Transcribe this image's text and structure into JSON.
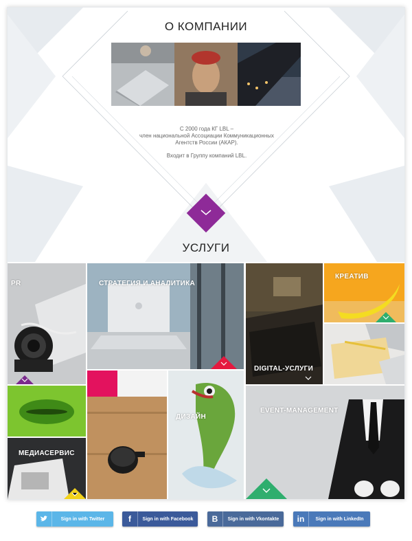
{
  "about": {
    "title": "О КОМПАНИИ",
    "desc_line1": "С 2000 года КГ LBL –",
    "desc_line2": "член национальной Ассоциации Коммуникационных",
    "desc_line3": "Агентств России (АКАР).",
    "desc_line4": "Входит в Группу компаний LBL."
  },
  "services": {
    "title": "УСЛУГИ",
    "tiles": [
      {
        "label": "PR",
        "accent": "#7b2b8e"
      },
      {
        "label": "СТРАТЕГИЯ И АНАЛИТИКА",
        "accent": "#e5193f"
      },
      {
        "label": "DIGITAL-УСЛУГИ",
        "accent": "#2b2b2b"
      },
      {
        "label": "КРЕАТИВ",
        "accent": "#2fae6e"
      },
      {
        "label": "МЕДИАСЕРВИС",
        "accent": "#f2d21b"
      },
      {
        "label": "ДИЗАЙН",
        "accent": ""
      },
      {
        "label": "EVENT-MANAGEMENT",
        "accent": "#2fae6e"
      }
    ]
  },
  "social": {
    "twitter": "Sign in with Twitter",
    "facebook": "Sign in with Facebook",
    "vkontakte": "Sign in with Vkontakte",
    "linkedin": "Sign in with LinkedIn",
    "twitter_color": "#5bb6e8",
    "facebook_color": "#3b5a9a",
    "vkontakte_color": "#4a6a9a",
    "linkedin_color": "#4a79b9"
  },
  "accent_color": "#8e2a98"
}
